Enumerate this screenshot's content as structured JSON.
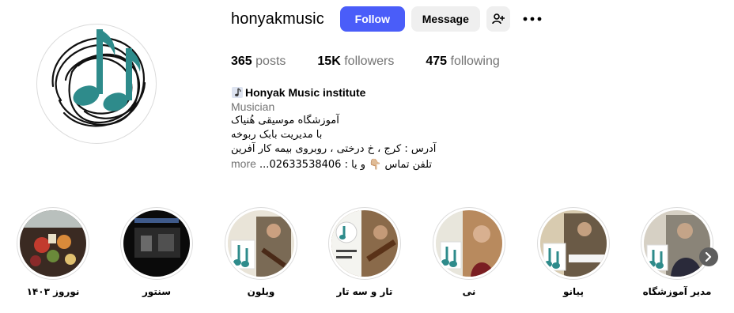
{
  "profile": {
    "username": "honyakmusic",
    "follow_label": "Follow",
    "message_label": "Message",
    "stats": [
      {
        "count": "365",
        "label": "posts"
      },
      {
        "count": "15K",
        "label": "followers"
      },
      {
        "count": "475",
        "label": "following"
      }
    ]
  },
  "bio": {
    "name": "Honyak Music institute",
    "category": "Musician",
    "lines": [
      "آموزشگاه موسیقی هُنیاک",
      "با مدیریت بابک ربوخه",
      "آدرس : کرج ، خ درختی ، روبروی بیمه کار آفرین",
      "تلفن تماس 👇🏼 و یا : 02633538406..."
    ],
    "more_label": "more"
  },
  "highlights": [
    {
      "label": "نوروز ۱۴۰۳"
    },
    {
      "label": "سنتور"
    },
    {
      "label": "ویلون"
    },
    {
      "label": "تار و سه تار"
    },
    {
      "label": "نی"
    },
    {
      "label": "پیانو"
    },
    {
      "label": "مدیر آموزشگاه"
    }
  ],
  "colors": {
    "follow_button": "#4a5df9",
    "secondary_button": "#efefef",
    "logo_teal": "#2e8b8b"
  },
  "icons": {
    "suggest": "person-plus-icon",
    "more": "more-options-icon",
    "next": "chevron-right-icon"
  }
}
